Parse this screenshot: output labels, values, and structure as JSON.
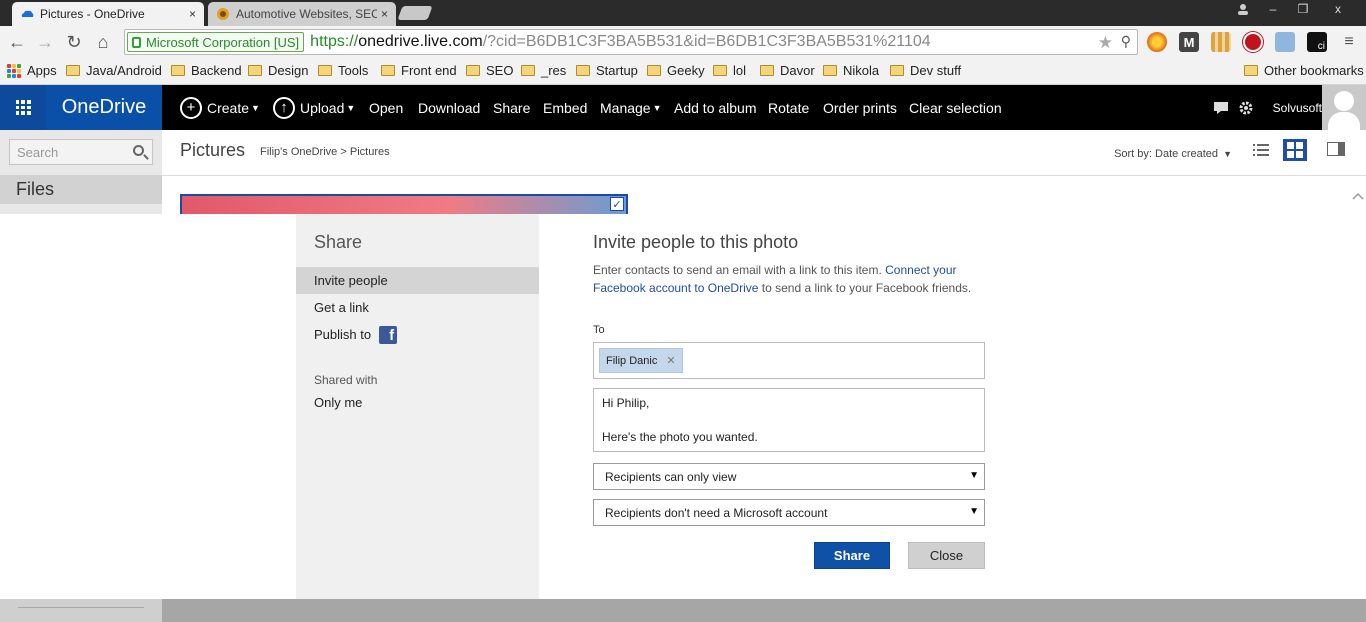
{
  "browser": {
    "tabs": [
      {
        "title": "Pictures - OneDrive",
        "close": "×",
        "active": true
      },
      {
        "title": "Automotive Websites, SEO",
        "close": "×",
        "active": false
      }
    ],
    "window_controls": {
      "minimize": "–",
      "maximize": "❐",
      "close": "x"
    },
    "address": {
      "ev_label": "Microsoft Corporation [US]",
      "scheme": "https://",
      "host": "onedrive.live.com",
      "path": "/?cid=B6DB1C3F3BA5B531&id=B6DB1C3F3BA5B531%21104"
    },
    "bookmarks": [
      "Apps",
      "Java/Android",
      "Backend",
      "Design",
      "Tools",
      "Front end",
      "SEO",
      "_res",
      "Startup",
      "Geeky",
      "lol",
      "Davor",
      "Nikola",
      "Dev stuff"
    ],
    "other_bookmarks": "Other bookmarks"
  },
  "app": {
    "brand": "OneDrive",
    "commands": {
      "create": "Create",
      "upload": "Upload",
      "open": "Open",
      "download": "Download",
      "share": "Share",
      "embed": "Embed",
      "manage": "Manage",
      "add_to_album": "Add to album",
      "rotate": "Rotate",
      "order_prints": "Order prints",
      "clear_selection": "Clear selection"
    },
    "account_name": "Solvusoft",
    "search_placeholder": "Search",
    "nav_files": "Files",
    "page_title": "Pictures",
    "breadcrumb": {
      "root": "Filip's OneDrive",
      "sep": ">",
      "current": "Pictures"
    },
    "sort_label": "Sort by: Date created"
  },
  "dialog": {
    "heading": "Share",
    "nav": {
      "invite": "Invite people",
      "link": "Get a link",
      "publish": "Publish to"
    },
    "shared_with_label": "Shared with",
    "shared_with_value": "Only me",
    "title": "Invite people to this photo",
    "desc_before": "Enter contacts to send an email with a link to this item. ",
    "desc_link": "Connect your Facebook account to OneDrive",
    "desc_after": " to send a link to your Facebook friends.",
    "to_label": "To",
    "recipient": "Filip Danic",
    "message_line1": "Hi Philip,",
    "message_line2": "Here's the photo you wanted.",
    "permission": "Recipients can only view",
    "account_requirement": "Recipients don't need a Microsoft account",
    "share_button": "Share",
    "close_button": "Close"
  },
  "colors": {
    "brand_blue": "#0a4fa8",
    "primary_button": "#0e51a7",
    "appbar": "#000000"
  }
}
